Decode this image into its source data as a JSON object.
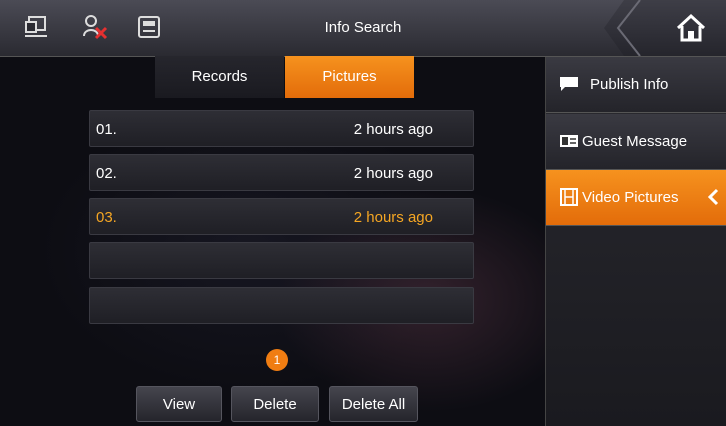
{
  "header": {
    "title": "Info Search",
    "icons": [
      "monitor-icon",
      "user-blocked-icon",
      "sd-card-icon",
      "home-icon"
    ]
  },
  "tabs": [
    {
      "label": "Records",
      "active": false
    },
    {
      "label": "Pictures",
      "active": true
    }
  ],
  "records": [
    {
      "index": "01.",
      "time": "2 hours ago",
      "selected": false
    },
    {
      "index": "02.",
      "time": "2 hours ago",
      "selected": false
    },
    {
      "index": "03.",
      "time": "2 hours ago",
      "selected": true
    },
    {
      "index": "",
      "time": "",
      "selected": false
    },
    {
      "index": "",
      "time": "",
      "selected": false
    }
  ],
  "pagination": {
    "current_page": "1"
  },
  "actions": {
    "view": "View",
    "delete": "Delete",
    "delete_all": "Delete All"
  },
  "sidebar": {
    "items": [
      {
        "label": "Publish Info",
        "icon": "message-icon",
        "active": false
      },
      {
        "label": "Guest Message",
        "icon": "guest-message-icon",
        "active": false
      },
      {
        "label": "Video Pictures",
        "icon": "film-icon",
        "active": true
      }
    ]
  },
  "colors": {
    "accent": "#f07d12",
    "selected_text": "#f5a623"
  }
}
